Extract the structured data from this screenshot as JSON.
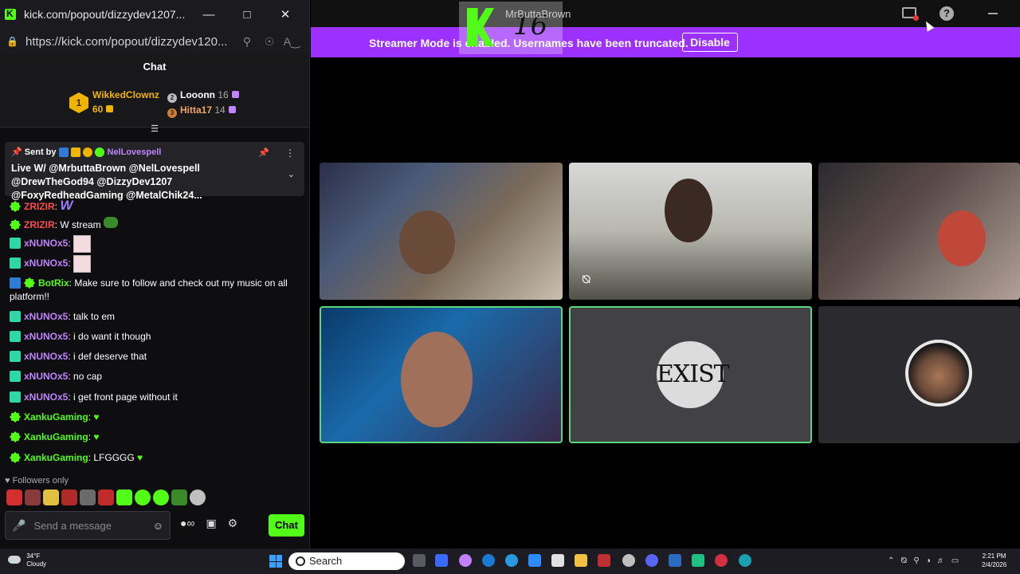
{
  "popout": {
    "title": "kick.com/popout/dizzydev1207...",
    "url": "https://kick.com/popout/dizzydev120...",
    "chat_header": "Chat"
  },
  "leaderboard": {
    "first": {
      "name": "WikkedClownz",
      "count": "60",
      "rank": "1"
    },
    "second": {
      "name": "Looonn",
      "count": "16",
      "rank": "2"
    },
    "third": {
      "name": "Hitta17",
      "count": "14",
      "rank": "3"
    }
  },
  "pinned": {
    "sent_by_label": "Sent by",
    "sender": "NelLovespell",
    "text": "Live W/ @MrbuttaBrown @NelLovespell @DrewTheGod94 @DizzyDev1207 @FoxyRedheadGaming @MetalChik24..."
  },
  "messages": [
    {
      "user": "ZRIZIR",
      "text": "",
      "emote": "W",
      "color": "#ff4d4d"
    },
    {
      "user": "ZRIZIR",
      "text": "W stream",
      "emote": "",
      "color": "#ff4d4d"
    },
    {
      "user": "xNUNOx5",
      "text": "",
      "emote": "img",
      "color": "#c084fc"
    },
    {
      "user": "xNUNOx5",
      "text": "",
      "emote": "img",
      "color": "#c084fc"
    },
    {
      "user": "BotRix",
      "text": "Make sure to follow and check out my music on all",
      "cont": "platform!!",
      "color": "#53fc18"
    },
    {
      "user": "xNUNOx5",
      "text": "talk to em",
      "color": "#c084fc"
    },
    {
      "user": "xNUNOx5",
      "text": "i do want it though",
      "color": "#c084fc"
    },
    {
      "user": "xNUNOx5",
      "text": "i def deserve that",
      "color": "#c084fc"
    },
    {
      "user": "xNUNOx5",
      "text": "no cap",
      "color": "#c084fc"
    },
    {
      "user": "xNUNOx5",
      "text": "i get front page without it",
      "color": "#c084fc"
    },
    {
      "user": "XankuGaming",
      "text": "",
      "heart": "♥",
      "color": "#53fc18"
    },
    {
      "user": "XankuGaming",
      "text": "",
      "heart": "♥",
      "color": "#53fc18"
    },
    {
      "user": "XankuGaming",
      "text": "LFGGGG",
      "heart": "♥",
      "color": "#53fc18"
    }
  ],
  "followers_only": "Followers only",
  "composer": {
    "placeholder": "Send a message",
    "send_label": "Chat"
  },
  "stream": {
    "streamer_name": "MrButtaBrown",
    "overlay_number": "16",
    "banner_text": "Streamer Mode is enabled. Usernames have been truncated.",
    "banner_button": "Disable",
    "exist_label": "EXIST"
  },
  "taskbar": {
    "weather_temp": "34°F",
    "weather_desc": "Cloudy",
    "search_placeholder": "Search",
    "time": "2:21 PM",
    "date": "2/4/2026"
  },
  "colors": {
    "kick_green": "#53fc18",
    "banner_purple": "#9b30ff",
    "accent_purple": "#c084fc"
  }
}
